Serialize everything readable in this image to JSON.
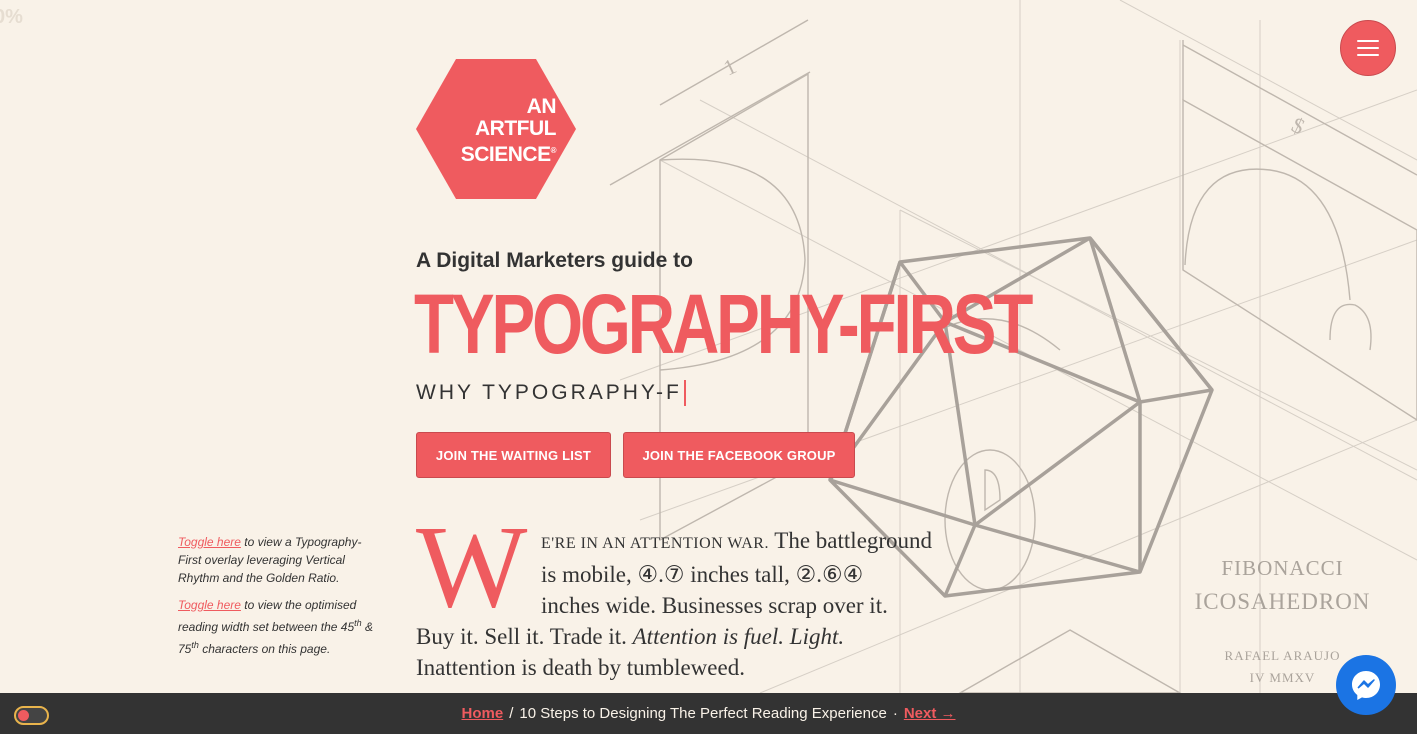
{
  "progress": {
    "label": "0%"
  },
  "logo": {
    "line1": "AN",
    "line2": "ARTFUL",
    "line3": "SCIENCE",
    "registered": "®"
  },
  "hero": {
    "kicker": "A Digital Marketers guide to",
    "title": "TYPOGRAPHY-FIRST",
    "subtitle": "WHY TYPOGRAPHY-F"
  },
  "buttons": {
    "waiting_list": "JOIN THE WAITING LIST",
    "facebook_group": "JOIN THE FACEBOOK GROUP"
  },
  "side_notes": {
    "note1_link": "Toggle here",
    "note1_text": " to view a Typography-First overlay leveraging Vertical Rhythm and the Golden Ratio.",
    "note2_link": "Toggle here",
    "note2_text_a": " to view the optimised reading width set between the 45",
    "note2_sup1": "th",
    "note2_text_b": " & 75",
    "note2_sup2": "th",
    "note2_text_c": " characters on this page."
  },
  "article": {
    "dropcap": "W",
    "line1_smallcaps": "E'RE IN AN ATTENTION WAR.",
    "line1_rest": " The battleground",
    "line2": "is mobile, ④.⑦ inches tall, ②.⑥④",
    "line3": "inches wide. Businesses scrap over it.",
    "line4_plain": "Buy it. Sell it. Trade it. ",
    "line4_italic": "Attention is fuel. Light.",
    "line5": "Inattention is death by tumbleweed."
  },
  "illustration_caption": {
    "line1": "FIBONACCI",
    "line2": "ICOSAHEDRON",
    "line3": "RAFAEL ARAUJO",
    "line4": "IV MMXV"
  },
  "bottom_bar": {
    "home": "Home",
    "separator": "/",
    "title": "10 Steps to Designing The Perfect Reading Experience",
    "dot": "·",
    "next": "Next →"
  },
  "icons": {
    "menu": "hamburger-icon",
    "messenger": "messenger-icon",
    "toggle": "overlay-toggle"
  },
  "colors": {
    "accent": "#ef5b5f",
    "background": "#f9f2e8",
    "bar": "#333333",
    "messenger": "#1b74e4"
  }
}
